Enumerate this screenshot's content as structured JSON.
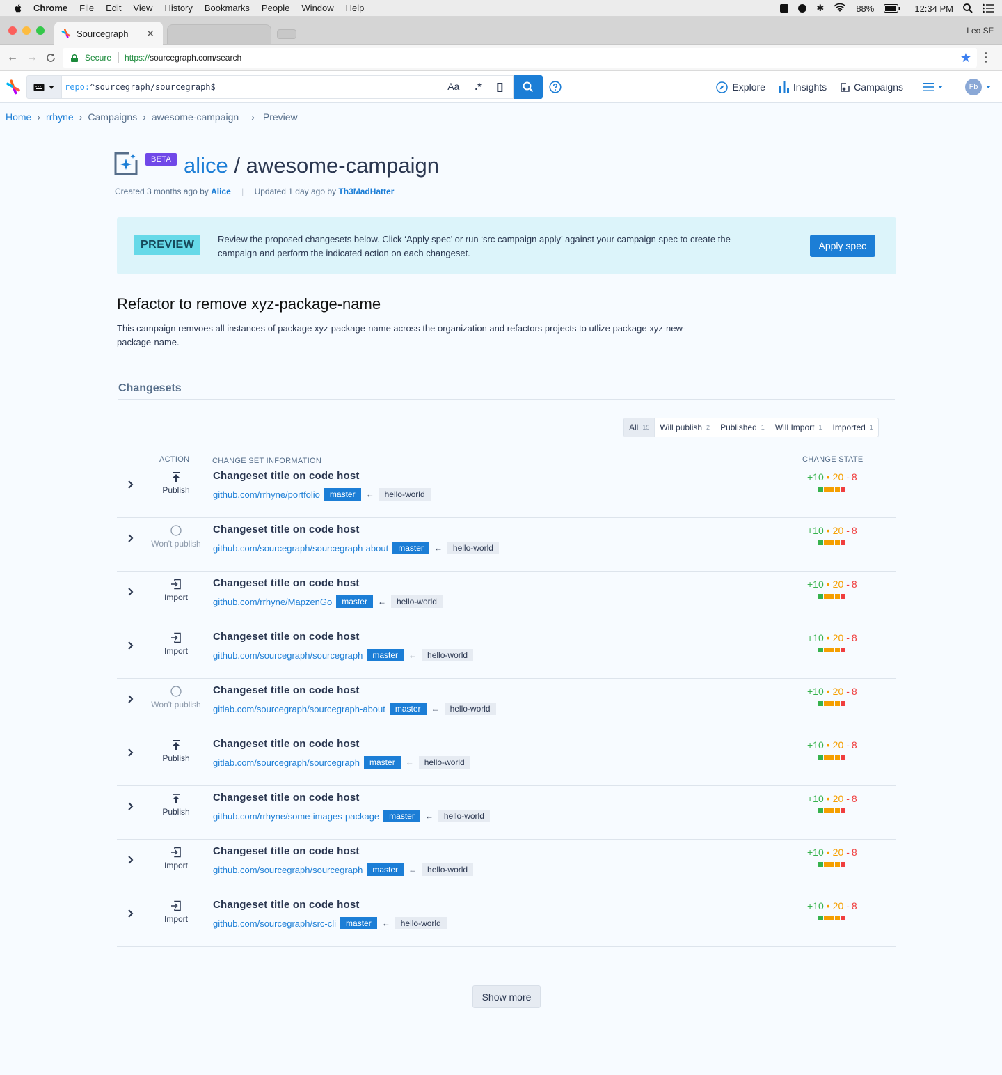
{
  "menubar": {
    "items": [
      "Chrome",
      "File",
      "Edit",
      "View",
      "History",
      "Bookmarks",
      "People",
      "Window",
      "Help"
    ],
    "battery": "88%",
    "time": "12:34 PM"
  },
  "browser": {
    "tab_title": "Sourcegraph",
    "profile": "Leo SF",
    "secure_label": "Secure",
    "url_scheme": "https://",
    "url_host": "sourcegraph.com/search"
  },
  "sgnav": {
    "query_key": "repo:",
    "query_value": "^sourcegraph/sourcegraph$",
    "opt_case": "Aa",
    "opt_regex": ".*",
    "opt_structural": "[]",
    "links": [
      "Explore",
      "Insights",
      "Campaigns"
    ],
    "avatar": "Fb"
  },
  "breadcrumbs": [
    "Home",
    "rrhyne",
    "Campaigns",
    "awesome-campaign",
    "Preview"
  ],
  "header": {
    "badge": "BETA",
    "namespace": "alice",
    "separator": " / ",
    "name": "awesome-campaign",
    "created_prefix": "Created 3 months ago by ",
    "created_by": "Alice",
    "updated_prefix": "Updated 1 day ago by ",
    "updated_by": "Th3MadHatter"
  },
  "banner": {
    "badge": "PREVIEW",
    "text": "Review the proposed changesets below. Click ‘Apply spec’ or run ‘src campaign apply’ against your campaign spec to create the campaign and perform the indicated action on each changeset.",
    "button": "Apply spec"
  },
  "spec": {
    "title": "Refactor to remove xyz-package-name",
    "description": "This campaign remvoes all instances of package xyz-package-name across the organization and refactors projects to utlize package xyz-new-package-name."
  },
  "changesets": {
    "heading": "Changesets",
    "filters": [
      {
        "label": "All",
        "count": "15"
      },
      {
        "label": "Will publish",
        "count": "2"
      },
      {
        "label": "Published",
        "count": "1"
      },
      {
        "label": "Will Import",
        "count": "1"
      },
      {
        "label": "Imported",
        "count": "1"
      }
    ],
    "columns": {
      "action": "ACTION",
      "info": "CHANGE SET INFORMATION",
      "state": "CHANGE STATE"
    },
    "rows": [
      {
        "action": "Publish",
        "icon": "publish-icon",
        "title": "Changeset title on code host",
        "repo": "github.com/rrhyne/portfolio",
        "base": "master",
        "head": "hello-world",
        "added": "+10",
        "changed": "20",
        "deleted": "8"
      },
      {
        "action": "Won't publish",
        "icon": "circle-icon",
        "title": "Changeset title on code host",
        "repo": "github.com/sourcegraph/sourcegraph-about",
        "base": "master",
        "head": "hello-world",
        "added": "+10",
        "changed": "20",
        "deleted": "8"
      },
      {
        "action": "Import",
        "icon": "import-icon",
        "title": "Changeset title on code host",
        "repo": "github.com/rrhyne/MapzenGo",
        "base": "master",
        "head": "hello-world",
        "added": "+10",
        "changed": "20",
        "deleted": "8"
      },
      {
        "action": "Import",
        "icon": "import-icon",
        "title": "Changeset title on code host",
        "repo": "github.com/sourcegraph/sourcegraph",
        "base": "master",
        "head": "hello-world",
        "added": "+10",
        "changed": "20",
        "deleted": "8"
      },
      {
        "action": "Won't publish",
        "icon": "circle-icon",
        "title": "Changeset title on code host",
        "repo": "gitlab.com/sourcegraph/sourcegraph-about",
        "base": "master",
        "head": "hello-world",
        "added": "+10",
        "changed": "20",
        "deleted": "8"
      },
      {
        "action": "Publish",
        "icon": "publish-icon",
        "title": "Changeset title on code host",
        "repo": "gitlab.com/sourcegraph/sourcegraph",
        "base": "master",
        "head": "hello-world",
        "added": "+10",
        "changed": "20",
        "deleted": "8"
      },
      {
        "action": "Publish",
        "icon": "publish-icon",
        "title": "Changeset title on code host",
        "repo": "github.com/rrhyne/some-images-package",
        "base": "master",
        "head": "hello-world",
        "added": "+10",
        "changed": "20",
        "deleted": "8"
      },
      {
        "action": "Import",
        "icon": "import-icon",
        "title": "Changeset title on code host",
        "repo": "github.com/sourcegraph/sourcegraph",
        "base": "master",
        "head": "hello-world",
        "added": "+10",
        "changed": "20",
        "deleted": "8"
      },
      {
        "action": "Import",
        "icon": "import-icon",
        "title": "Changeset title on code host",
        "repo": "github.com/sourcegraph/src-cli",
        "base": "master",
        "head": "hello-world",
        "added": "+10",
        "changed": "20",
        "deleted": "8"
      }
    ],
    "diff_colors": {
      "added": "#37b24d",
      "changed": "#f59f00",
      "deleted": "#f03e3e"
    },
    "show_more": "Show more"
  }
}
